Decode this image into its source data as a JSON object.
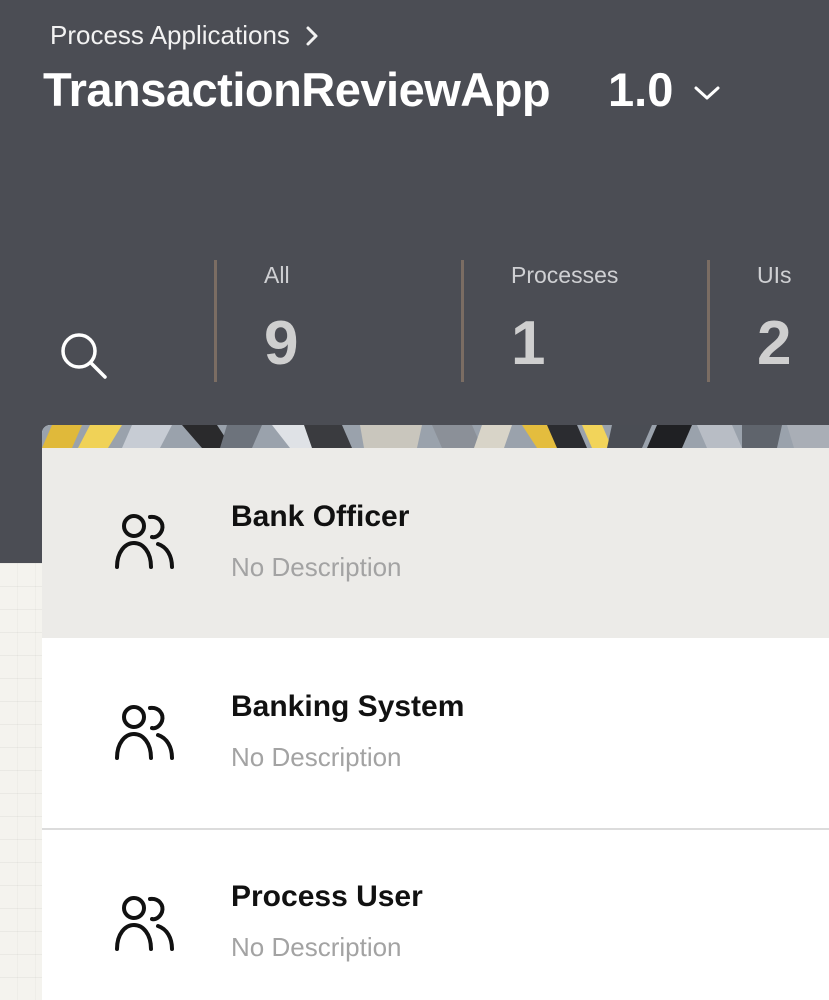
{
  "breadcrumb": {
    "label": "Process Applications"
  },
  "app": {
    "name": "TransactionReviewApp",
    "version": "1.0"
  },
  "search": {
    "icon": "search-icon"
  },
  "stats": [
    {
      "label": "All",
      "count": "9"
    },
    {
      "label": "Processes",
      "count": "1"
    },
    {
      "label": "UIs",
      "count": "2"
    }
  ],
  "roles": [
    {
      "title": "Bank Officer",
      "description": "No Description",
      "icon": "users-icon",
      "selected": true
    },
    {
      "title": "Banking System",
      "description": "No Description",
      "icon": "users-icon",
      "selected": false
    },
    {
      "title": "Process User",
      "description": "No Description",
      "icon": "users-icon",
      "selected": false
    }
  ],
  "colors": {
    "header_bg": "#4b4d54",
    "selected_row": "#ecebe8",
    "description_text": "#a3a3a3",
    "divider": "#7b6d63"
  }
}
